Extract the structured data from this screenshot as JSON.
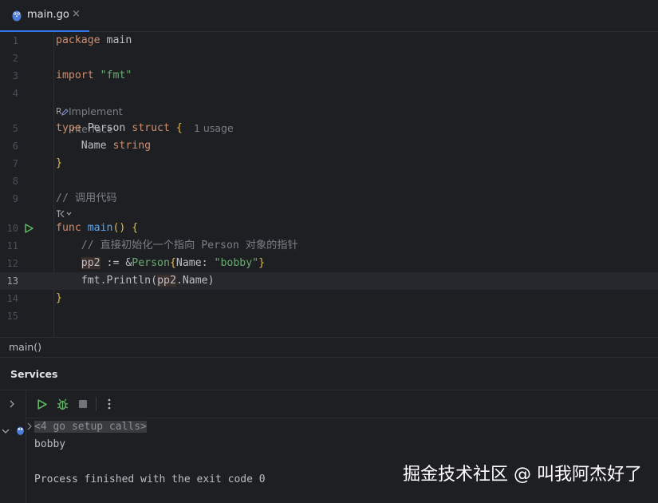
{
  "tab": {
    "label": "main.go",
    "close": "×"
  },
  "editor": {
    "lines": [
      {
        "n": "1"
      },
      {
        "n": "2"
      },
      {
        "n": "3"
      },
      {
        "n": "4"
      },
      {
        "n": "5"
      },
      {
        "n": "6"
      },
      {
        "n": "7"
      },
      {
        "n": "8"
      },
      {
        "n": "9"
      },
      {
        "n": "10"
      },
      {
        "n": "11"
      },
      {
        "n": "12"
      },
      {
        "n": "13"
      },
      {
        "n": "14"
      },
      {
        "n": "15"
      }
    ],
    "code": {
      "l1_kw": "package",
      "l1_rest": " main",
      "l3_kw": "import",
      "l3_str": "\"fmt\"",
      "hint_impl": "Implement interface",
      "hint_impl_prefix": "R",
      "l5_kw1": "type",
      "l5_name": " Person ",
      "l5_kw2": "struct",
      "l5_brace": " {",
      "l5_usage": "1 usage",
      "l6_field": "    Name ",
      "l6_type": "string",
      "l7": "}",
      "l9_cmt": "// 调用代码",
      "l10_kw": "func",
      "l10_fn": " main",
      "l10_rest": "() {",
      "l11_cmt": "    // 直接初始化一个指向 Person 对象的指针",
      "l12_indent": "    ",
      "l12_var": "pp2",
      "l12_op": " := &",
      "l12_type": "Person",
      "l12_b1": "{",
      "l12_field": "Name: ",
      "l12_str": "\"bobby\"",
      "l12_b2": "}",
      "l13_indent": "    ",
      "l13_pkg": "fmt.",
      "l13_fn": "Println",
      "l13_p1": "(",
      "l13_var": "pp2",
      "l13_rest": ".Name)",
      "l14": "}"
    },
    "current_line": "13"
  },
  "breadcrumb": "main()",
  "services": {
    "title": "Services",
    "output": {
      "meta": "<4 go setup calls>",
      "line1": "bobby",
      "line2": "",
      "line3": "Process finished with the exit code 0"
    }
  },
  "watermark": "掘金技术社区 @ 叫我阿杰好了",
  "colors": {
    "accent": "#3574f0",
    "run": "#5fb865",
    "keyword": "#cf8e6d",
    "string": "#6aab73",
    "function": "#56a8f5"
  }
}
